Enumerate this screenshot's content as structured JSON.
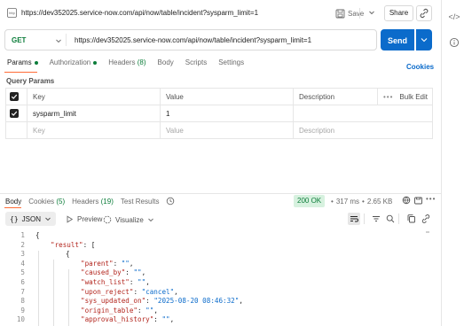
{
  "header": {
    "url": "https://dev352025.service-now.com/api/now/table/incident?sysparm_limit=1",
    "save_label": "Save",
    "share_label": "Share"
  },
  "request": {
    "method": "GET",
    "url": "https://dev352025.service-now.com/api/now/table/incident?sysparm_limit=1",
    "send_label": "Send"
  },
  "request_tabs": {
    "params": "Params",
    "authorization": "Authorization",
    "headers": "Headers",
    "headers_count": "(8)",
    "body": "Body",
    "scripts": "Scripts",
    "settings": "Settings",
    "cookies": "Cookies"
  },
  "query_params": {
    "title": "Query Params",
    "columns": {
      "key": "Key",
      "value": "Value",
      "description": "Description",
      "bulk_edit": "Bulk Edit"
    },
    "rows": [
      {
        "key": "sysparm_limit",
        "value": "1",
        "description": ""
      }
    ],
    "placeholder": {
      "key": "Key",
      "value": "Value",
      "description": "Description"
    }
  },
  "response": {
    "tabs": {
      "body": "Body",
      "cookies": "Cookies",
      "cookies_count": "(5)",
      "headers": "Headers",
      "headers_count": "(19)",
      "test_results": "Test Results"
    },
    "status": "200 OK",
    "time": "317 ms",
    "size": "2.65 KB",
    "format": "JSON",
    "preview_label": "Preview",
    "visualize_label": "Visualize",
    "colors": {
      "status_bg": "#d7f1df",
      "status_text": "#0c7d3a",
      "send": "#0b6bcb",
      "accent": "#ff6c37"
    }
  },
  "code_lines": [
    {
      "n": "1",
      "indent": 0,
      "parts": [
        [
          "p",
          "{"
        ]
      ]
    },
    {
      "n": "2",
      "indent": 1,
      "parts": [
        [
          "k",
          "\"result\""
        ],
        [
          "p",
          ": ["
        ]
      ]
    },
    {
      "n": "3",
      "indent": 2,
      "parts": [
        [
          "p",
          "{"
        ]
      ]
    },
    {
      "n": "4",
      "indent": 3,
      "parts": [
        [
          "k",
          "\"parent\""
        ],
        [
          "p",
          ": "
        ],
        [
          "s",
          "\"\""
        ],
        [
          "p",
          ","
        ]
      ]
    },
    {
      "n": "5",
      "indent": 3,
      "parts": [
        [
          "k",
          "\"caused_by\""
        ],
        [
          "p",
          ": "
        ],
        [
          "s",
          "\"\""
        ],
        [
          "p",
          ","
        ]
      ]
    },
    {
      "n": "6",
      "indent": 3,
      "parts": [
        [
          "k",
          "\"watch_list\""
        ],
        [
          "p",
          ": "
        ],
        [
          "s",
          "\"\""
        ],
        [
          "p",
          ","
        ]
      ]
    },
    {
      "n": "7",
      "indent": 3,
      "parts": [
        [
          "k",
          "\"upon_reject\""
        ],
        [
          "p",
          ": "
        ],
        [
          "s",
          "\"cancel\""
        ],
        [
          "p",
          ","
        ]
      ]
    },
    {
      "n": "8",
      "indent": 3,
      "parts": [
        [
          "k",
          "\"sys_updated_on\""
        ],
        [
          "p",
          ": "
        ],
        [
          "s",
          "\"2025-08-20 08:46:32\""
        ],
        [
          "p",
          ","
        ]
      ]
    },
    {
      "n": "9",
      "indent": 3,
      "parts": [
        [
          "k",
          "\"origin_table\""
        ],
        [
          "p",
          ": "
        ],
        [
          "s",
          "\"\""
        ],
        [
          "p",
          ","
        ]
      ]
    },
    {
      "n": "10",
      "indent": 3,
      "parts": [
        [
          "k",
          "\"approval_history\""
        ],
        [
          "p",
          ": "
        ],
        [
          "s",
          "\"\""
        ],
        [
          "p",
          ","
        ]
      ]
    }
  ]
}
